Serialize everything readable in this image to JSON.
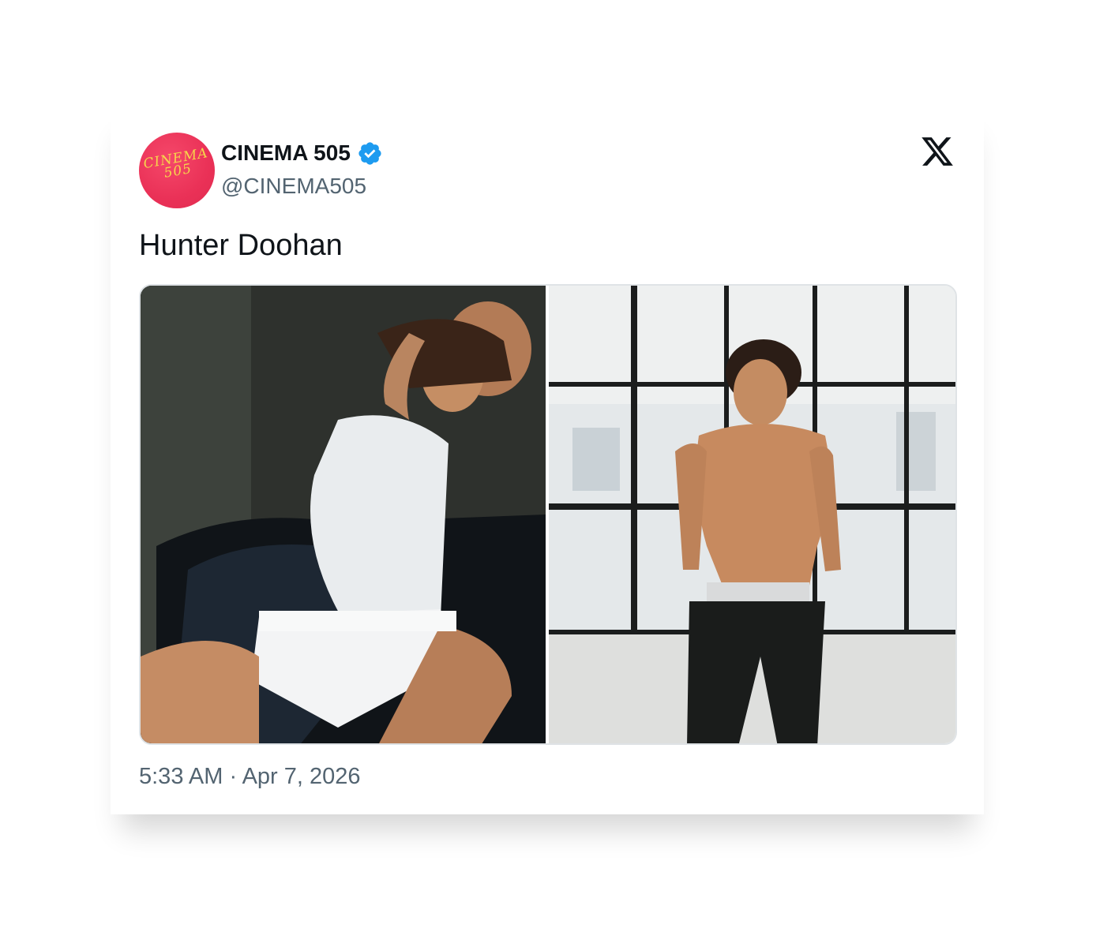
{
  "account": {
    "display_name": "CINEMA 505",
    "handle": "@CINEMA505",
    "verified": true,
    "avatar_logo_text": "CINEMA 505"
  },
  "tweet": {
    "text": "Hunter Doohan",
    "timestamp": "5:33 AM · Apr 7, 2026",
    "photos": [
      {
        "description_icon": "photo-icon",
        "alt": ""
      },
      {
        "description_icon": "photo-icon",
        "alt": ""
      }
    ]
  },
  "colors": {
    "verified_badge": "#1d9bf0",
    "avatar_background": "#ea3157",
    "avatar_text": "#f6d64a",
    "secondary_text": "#536471",
    "primary_text": "#0f1419"
  },
  "icons": {
    "platform": "x-logo-icon",
    "verified": "verified-badge-icon"
  }
}
